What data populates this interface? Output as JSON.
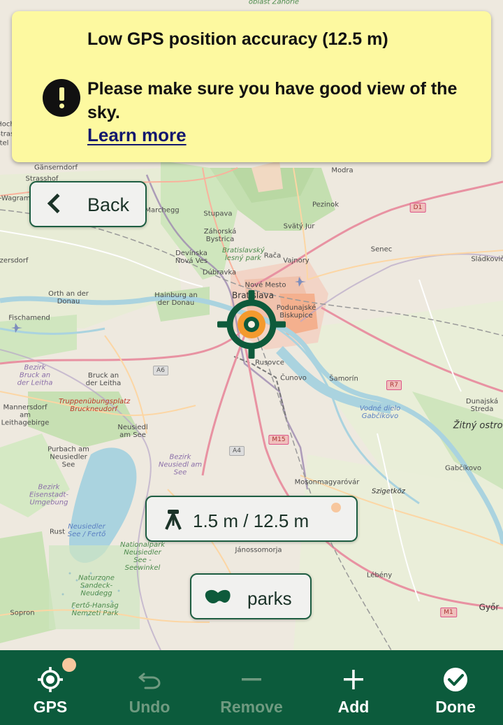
{
  "banner": {
    "title": "Low GPS position accuracy (12.5 m)",
    "message": "Please make sure you have good view of the sky.",
    "link": "Learn more"
  },
  "back_button": {
    "label": "Back"
  },
  "accuracy": {
    "text": "1.5 m / 12.5 m"
  },
  "filter": {
    "label": "parks"
  },
  "toolbar": {
    "gps": "GPS",
    "undo": "Undo",
    "remove": "Remove",
    "add": "Add",
    "done": "Done"
  },
  "map": {
    "labels": {
      "bratislava": "Bratislava",
      "petrzalka": "Podunajské Biskupice",
      "rusovce": "Rusovce",
      "cunovo": "Čunovo",
      "samorin": "Šamorín",
      "senec": "Senec",
      "sladkovicovo": "Sládkovič",
      "pezinok": "Pezinok",
      "modra": "Modra",
      "svaty_jur": "Svätý Jur",
      "vajnory": "Vajnory",
      "raca": "Rača",
      "nove_mesto": "Nové Mesto",
      "dubravka": "Dúbravka",
      "devinska": "Devínska Nová Ves",
      "zahorska": "Záhorská Bystrica",
      "stupava": "Stupava",
      "marchegg": "Marchegg",
      "ganserndorf": "Gänserndorf",
      "strasshof": "Strasshof",
      "wagram": "n-Wagram",
      "enzersdorf": "zersdorf",
      "orth": "Orth an der Donau",
      "fischamend": "Fischamend",
      "hainburg": "Hainburg an der Donau",
      "bruck_leitha": "Bruck an der Leitha",
      "bezirk_bruck": "Bezirk Bruck an der Leitha",
      "truppen": "Truppenübungsplatz Bruckneudorf",
      "mannersdorf": "Mannersdorf am Leithagebirge",
      "neusiedl": "Neusiedl am See",
      "bezirk_neusiedl": "Bezirk Neusiedl am See",
      "purbach": "Purbach am Neusiedler See",
      "bezirk_eisenstadt": "Bezirk Eisenstadt-Umgebung",
      "rust": "Rust",
      "lake": "Neusiedler See / Fertő",
      "nationalpark": "Nationalpark Neusiedler See - Seewinkel",
      "naturzone": "Naturzone Sandeck-Neudegg",
      "ferto_hansag": "Fertő-Hanság Nemzeti Park",
      "sopron": "Sopron",
      "mosonmagyarovar": "Mosonmagyaróvár",
      "szigetkoz": "Szigetköz",
      "lebeny": "Lébény",
      "gyor": "Győr",
      "gabcikovo": "Gabčíkovo",
      "zitny": "Žitný ostrov",
      "dunajska": "Dunajská Streda",
      "vodne_dielo": "Vodné dielo Gabčíkovo",
      "janossomorja": "Jánossomorja",
      "bratislavsky_park": "Bratislavský lesný park",
      "oblast": "oblasť Záhorie",
      "hoch": "Hoch",
      "strass": "Strass",
      "tel": "tel"
    },
    "shields": {
      "d1": "D1",
      "a6": "A6",
      "a4": "A4",
      "m15": "M15",
      "r7": "R7",
      "m1": "M1"
    }
  }
}
